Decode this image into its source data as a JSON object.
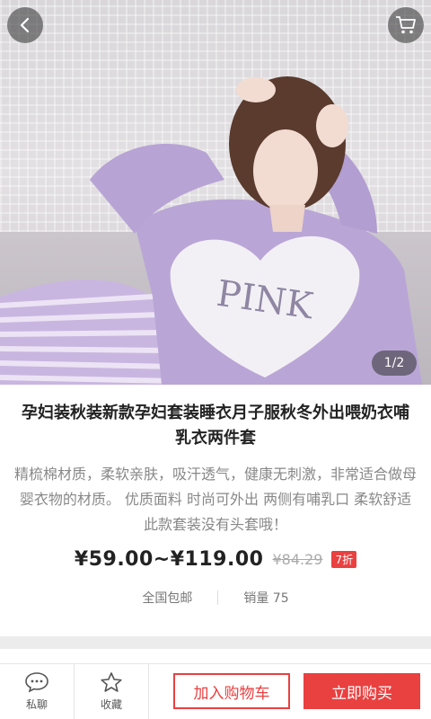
{
  "hero": {
    "image_subject": "woman in lavender pajamas with PINK print",
    "print_text": "PINK",
    "pager": "1/2"
  },
  "icons": {
    "back": "back-arrow-icon",
    "cart": "shopping-cart-icon",
    "chat": "chat-bubble-icon",
    "favorite": "star-icon"
  },
  "product": {
    "title": "孕妇装秋装新款孕妇套装睡衣月子服秋冬外出喂奶衣哺乳衣两件套",
    "description": "精梳棉材质，柔软亲肤，吸汗透气，健康无刺激，非常适合做母婴衣物的材质。 优质面料 时尚可外出 两侧有哺乳口 柔软舒适 此款套装没有头套哦！",
    "price": "¥59.00~¥119.00",
    "original_price": "¥84.29",
    "discount": "7折",
    "shipping": "全国包邮",
    "sales": "销量 75"
  },
  "bottom_bar": {
    "chat_label": "私聊",
    "favorite_label": "收藏",
    "add_cart_label": "加入购物车",
    "buy_label": "立即购买"
  },
  "colors": {
    "accent": "#e94040",
    "lavender": "#b9a6d6"
  }
}
